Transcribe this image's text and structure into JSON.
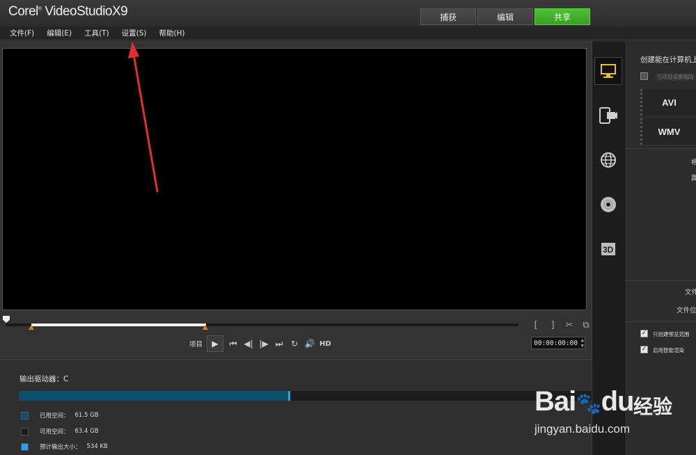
{
  "app": {
    "brand": "Corel",
    "product": "VideoStudio",
    "version": "X9"
  },
  "tabs": [
    {
      "label": "捕获",
      "active": false
    },
    {
      "label": "编辑",
      "active": false
    },
    {
      "label": "共享",
      "active": true
    }
  ],
  "menu": [
    {
      "label": "文件(F)"
    },
    {
      "label": "编辑(E)"
    },
    {
      "label": "工具(T)"
    },
    {
      "label": "设置(S)"
    },
    {
      "label": "帮助(H)"
    }
  ],
  "player": {
    "mode_label": "项目",
    "hd_label": "HD",
    "timecode": "00:00:00:00",
    "trim_in": 0.05,
    "trim_out": 0.39
  },
  "output": {
    "drive_label": "输出驱动器：C",
    "used_fraction": 0.47,
    "legend": [
      {
        "label": "已用空间：",
        "value": "61.5 GB",
        "color": "#0d4f6e"
      },
      {
        "label": "可用空间：",
        "value": "63.4 GB",
        "color": "#1c1c1c"
      },
      {
        "label": "预计输出大小：",
        "value": "534 KB",
        "color": "#2aa0e6"
      }
    ]
  },
  "sidebar": {
    "icons": [
      {
        "name": "computer-icon",
        "active": true
      },
      {
        "name": "device-icon",
        "active": false
      },
      {
        "name": "web-icon",
        "active": false
      },
      {
        "name": "disc-icon",
        "active": false
      },
      {
        "name": "3d-icon",
        "active": false
      }
    ]
  },
  "settings": {
    "title": "创建能在计算机上",
    "same_as_project": "与项目设置相同",
    "formats": [
      "AVI",
      "WMV"
    ],
    "cut_label_1": "格",
    "cut_label_2": "属",
    "file_name_label": "文件",
    "file_location_label": "文件位",
    "only_preview_range": "只创建预览范围",
    "smart_render": "启用智能渲染"
  },
  "watermark": {
    "brand": "Bai",
    "brand2": "du",
    "cn": "经验",
    "url": "jingyan.baidu.com"
  },
  "colors": {
    "accent": "#3fb02a",
    "marker": "#e07a1f",
    "annotation": "#e03030"
  }
}
